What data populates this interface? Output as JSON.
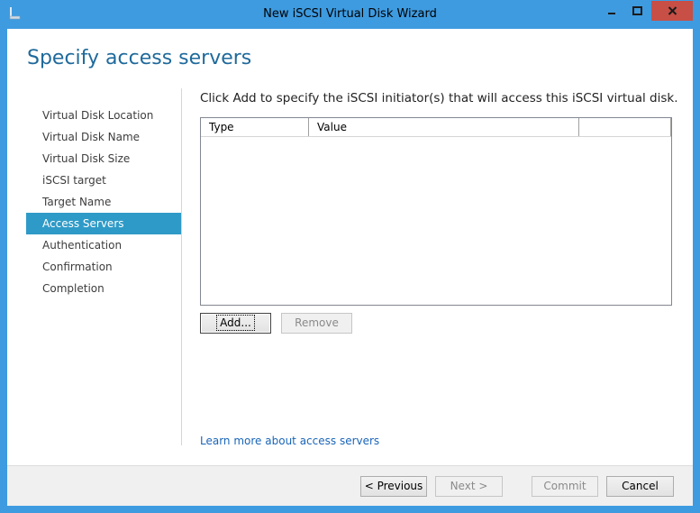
{
  "window": {
    "title": "New iSCSI Virtual Disk Wizard",
    "controls": [
      "minimize-icon",
      "maximize-icon",
      "close-icon"
    ]
  },
  "header": {
    "title": "Specify access servers"
  },
  "nav": {
    "items": [
      {
        "label": "Virtual Disk Location",
        "active": false
      },
      {
        "label": "Virtual Disk Name",
        "active": false
      },
      {
        "label": "Virtual Disk Size",
        "active": false
      },
      {
        "label": "iSCSI target",
        "active": false
      },
      {
        "label": "Target Name",
        "active": false
      },
      {
        "label": "Access Servers",
        "active": true
      },
      {
        "label": "Authentication",
        "active": false
      },
      {
        "label": "Confirmation",
        "active": false
      },
      {
        "label": "Completion",
        "active": false
      }
    ]
  },
  "main": {
    "instruction": "Click Add to specify the  iSCSI initiator(s) that will access  this iSCSI virtual disk.",
    "table": {
      "columns": [
        "Type",
        "Value",
        ""
      ],
      "rows": []
    },
    "add_label": "Add...",
    "remove_label": "Remove",
    "learn_more": "Learn more about access servers"
  },
  "footer": {
    "previous": "< Previous",
    "next": "Next >",
    "commit": "Commit",
    "cancel": "Cancel"
  },
  "colors": {
    "window_frame": "#3e9be0",
    "close_button": "#c74f46",
    "active_nav": "#2e9ac7",
    "title_text": "#1f6a9c",
    "link": "#1a65b8"
  }
}
